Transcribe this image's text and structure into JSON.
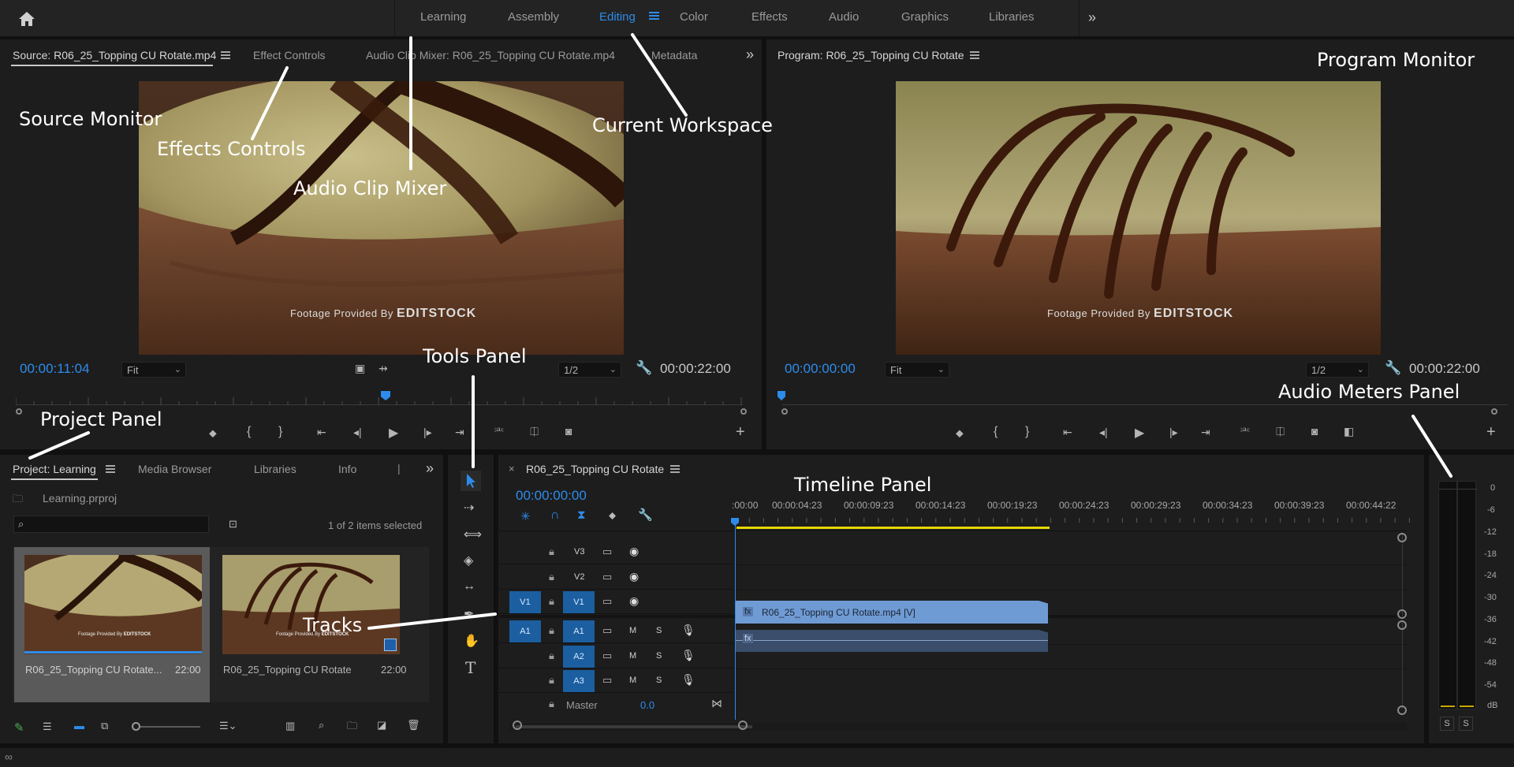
{
  "workspace": {
    "tabs": [
      "Learning",
      "Assembly",
      "Editing",
      "Color",
      "Effects",
      "Audio",
      "Graphics",
      "Libraries"
    ],
    "active_tab": "Editing"
  },
  "source_panel": {
    "tabs": [
      "Source: R06_25_Topping CU Rotate.mp4",
      "Effect Controls",
      "Audio Clip Mixer: R06_25_Topping CU Rotate.mp4",
      "Metadata"
    ],
    "timecode": "00:00:11:04",
    "fit": "Fit",
    "resolution": "1/2",
    "duration": "00:00:22:00",
    "credit_prefix": "Footage Provided By",
    "credit_brand": "EDITSTOCK"
  },
  "program_panel": {
    "tab": "Program: R06_25_Topping CU Rotate",
    "timecode": "00:00:00:00",
    "fit": "Fit",
    "resolution": "1/2",
    "duration": "00:00:22:00",
    "credit_prefix": "Footage Provided By",
    "credit_brand": "EDITSTOCK"
  },
  "project_panel": {
    "tabs": [
      "Project: Learning",
      "Media Browser",
      "Libraries",
      "Info"
    ],
    "file": "Learning.prproj",
    "selection": "1 of 2 items selected",
    "items": [
      {
        "name": "R06_25_Topping CU Rotate...",
        "duration": "22:00"
      },
      {
        "name": "R06_25_Topping CU Rotate",
        "duration": "22:00"
      }
    ],
    "thumb_credit_prefix": "Footage Provided By",
    "thumb_credit_brand": "EDITSTOCK"
  },
  "timeline_panel": {
    "tab": "R06_25_Topping CU Rotate",
    "timecode": "00:00:00:00",
    "ruler": [
      ":00:00",
      "00:00:04:23",
      "00:00:09:23",
      "00:00:14:23",
      "00:00:19:23",
      "00:00:24:23",
      "00:00:29:23",
      "00:00:34:23",
      "00:00:39:23",
      "00:00:44:22"
    ],
    "video_tracks": [
      "V3",
      "V2",
      "V1"
    ],
    "audio_tracks": [
      "A1",
      "A2",
      "A3"
    ],
    "source_v": "V1",
    "source_a": "A1",
    "master_label": "Master",
    "master_value": "0.0",
    "clip_name": "R06_25_Topping CU Rotate.mp4 [V]",
    "clip_fx": "fx",
    "mute": "M",
    "solo": "S"
  },
  "audio_meters": {
    "scale": [
      "0",
      "-6",
      "-12",
      "-18",
      "-24",
      "-30",
      "-36",
      "-42",
      "-48",
      "-54",
      "dB"
    ],
    "solo_buttons": [
      "S",
      "S"
    ]
  },
  "annotations": {
    "source_monitor": "Source Monitor",
    "effects_controls": "Effects Controls",
    "audio_clip_mixer": "Audio Clip Mixer",
    "current_workspace": "Current Workspace",
    "program_monitor": "Program Monitor",
    "tools_panel": "Tools Panel",
    "project_panel": "Project Panel",
    "timeline_panel": "Timeline Panel",
    "audio_meters_panel": "Audio Meters Panel",
    "tracks": "Tracks"
  },
  "colors": {
    "accent": "#2d8ceb",
    "clip_video": "#6f9bd4",
    "clip_audio": "#3a4e6b",
    "work_area": "#e6d800",
    "target_blue": "#1b5fa0"
  }
}
